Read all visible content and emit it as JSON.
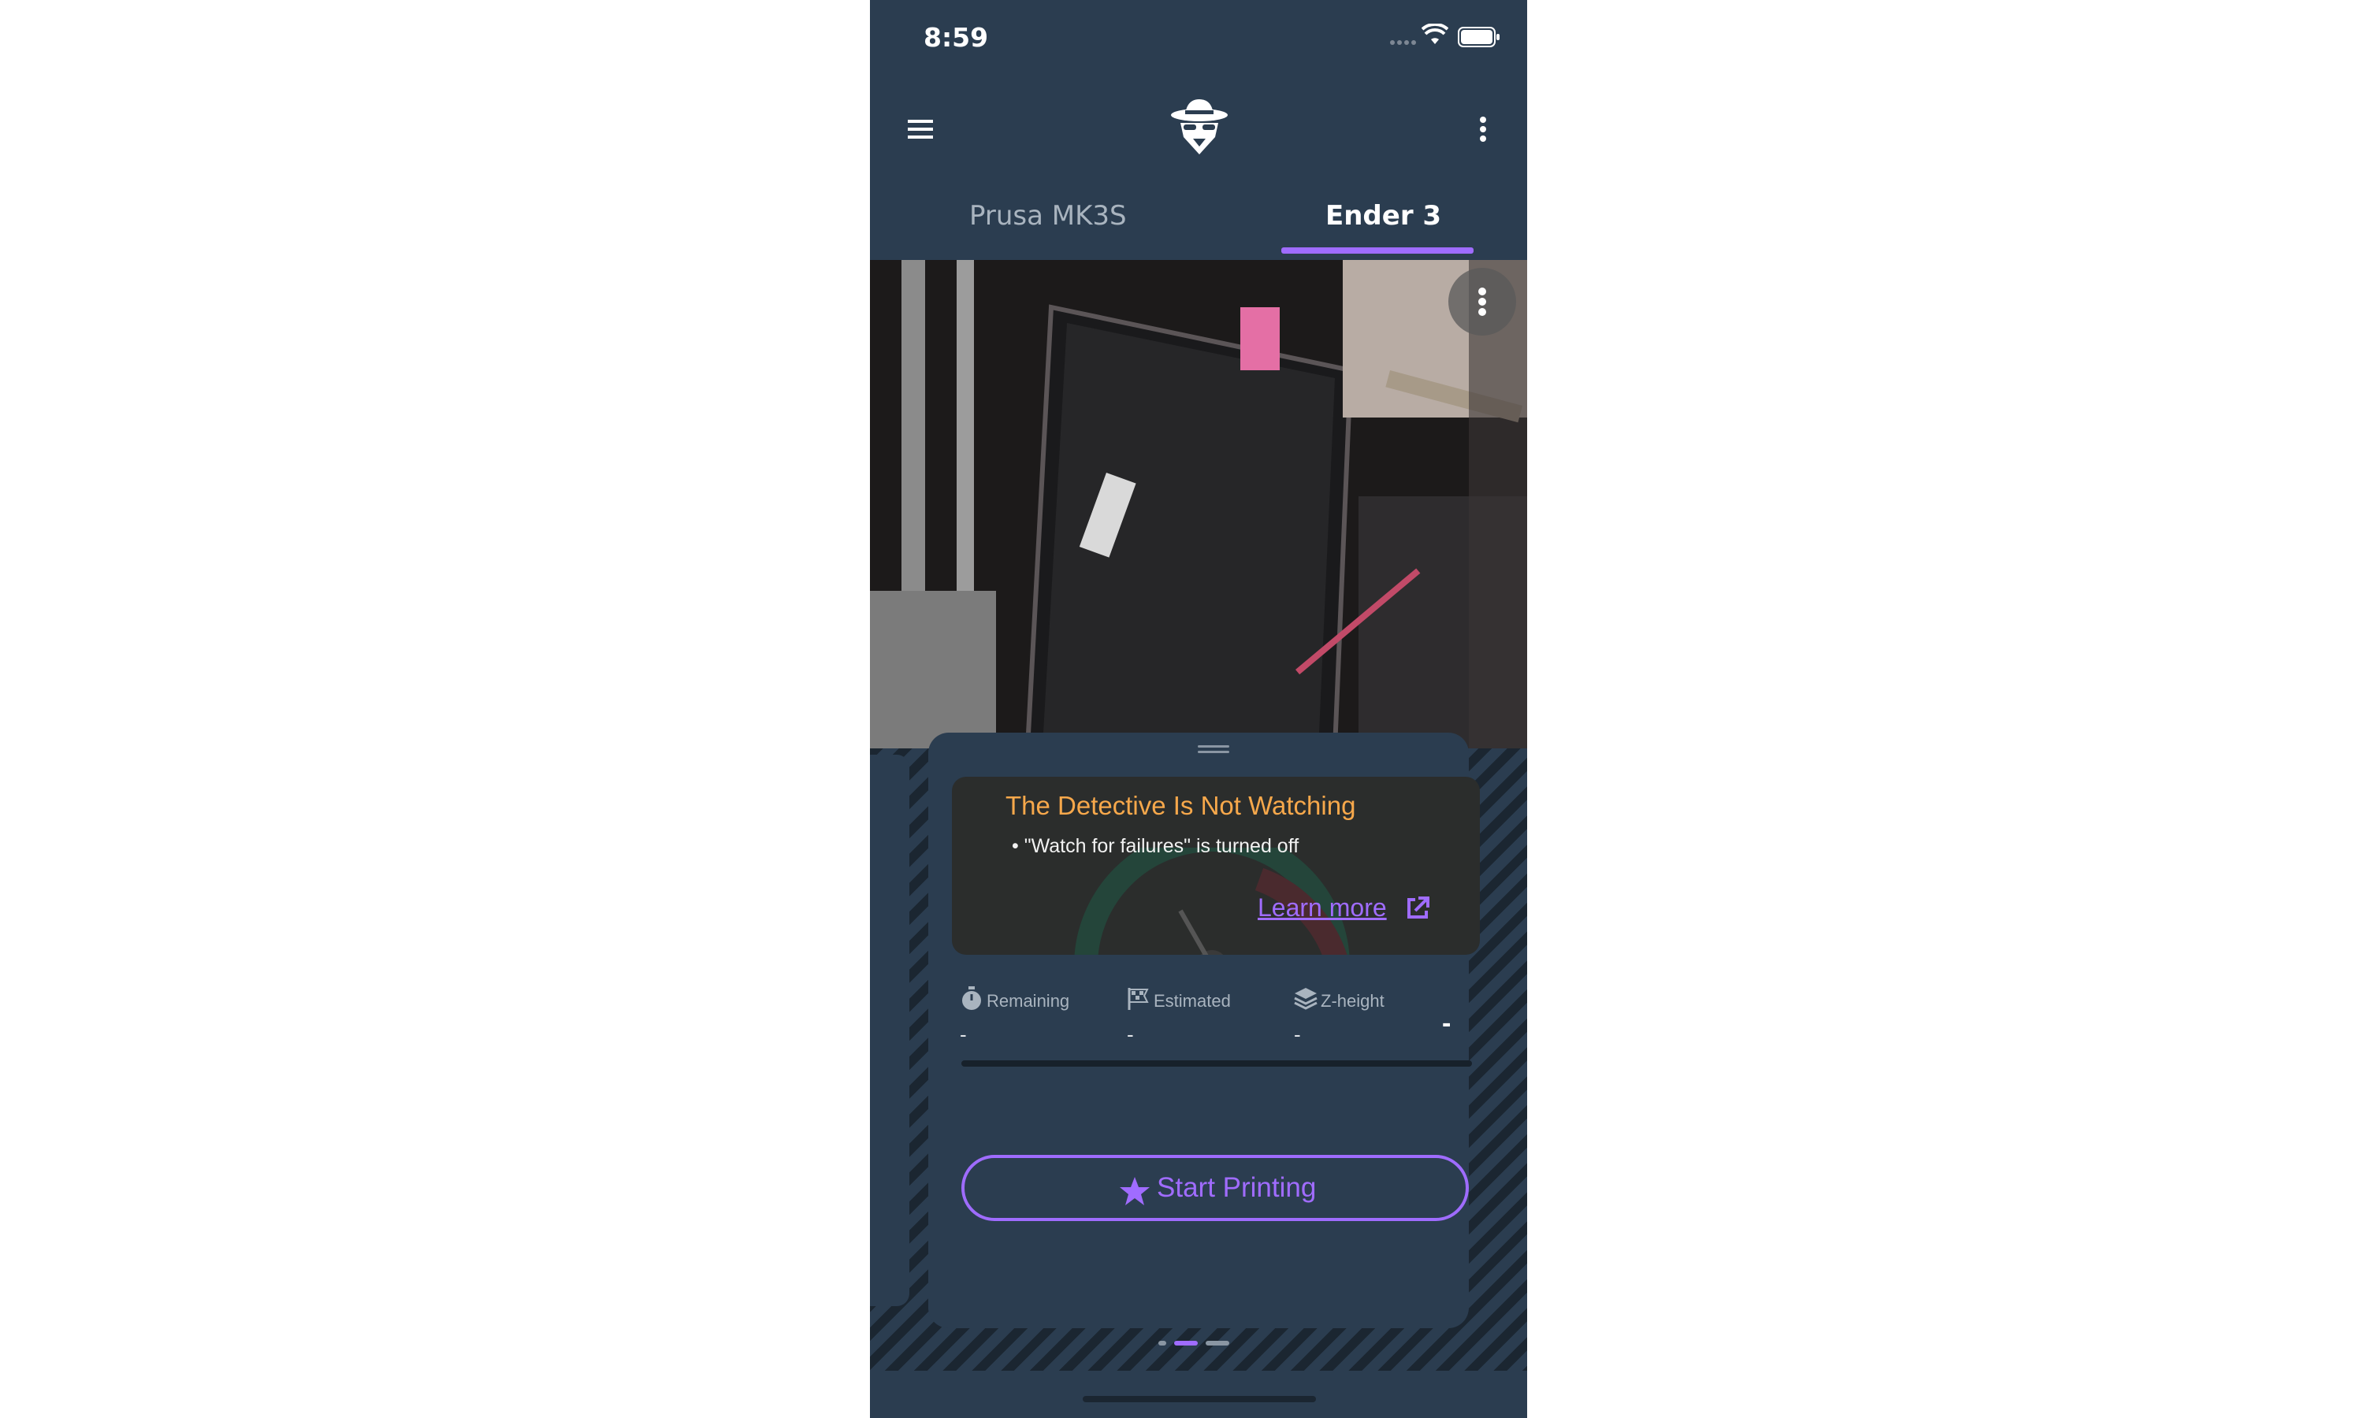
{
  "status_bar": {
    "time": "8:59"
  },
  "tabs": [
    {
      "label": "Prusa MK3S",
      "active": false
    },
    {
      "label": "Ender 3",
      "active": true
    }
  ],
  "alert": {
    "title": "The Detective Is Not Watching",
    "bullet": "• \"Watch for failures\" is turned off",
    "learn_more": "Learn more"
  },
  "stats": {
    "remaining": {
      "label": "Remaining",
      "value": "-"
    },
    "estimated": {
      "label": "Estimated",
      "value": "-"
    },
    "zheight": {
      "label": "Z-height",
      "value": "-"
    }
  },
  "progress": {
    "percent_text": "-",
    "fraction": 0
  },
  "start_button": {
    "label": "Start Printing"
  },
  "page_indicator": {
    "count": 3,
    "active_index": 1
  },
  "colors": {
    "accent": "#9f6cff",
    "warning": "#f7a84b",
    "background": "#2b3d50"
  },
  "icons": {
    "menu": "hamburger-icon",
    "logo": "detective-logo",
    "more": "more-vertical-icon",
    "external": "external-link-icon",
    "remaining": "stopwatch-icon",
    "estimated": "flag-checkered-icon",
    "zheight": "layers-icon",
    "start": "star-icon"
  }
}
